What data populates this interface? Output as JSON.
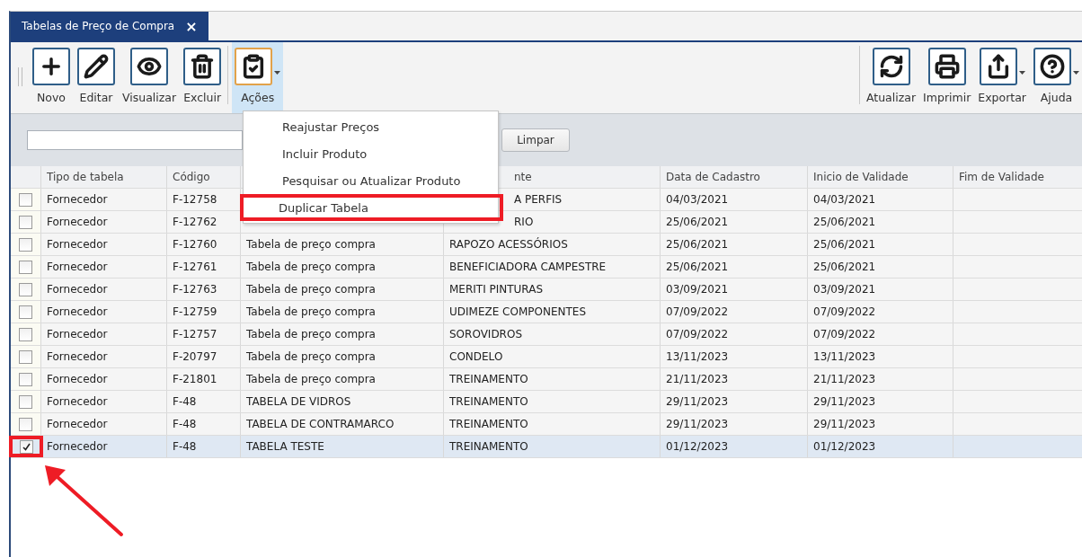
{
  "tab": {
    "title": "Tabelas de Preço de Compra",
    "close": "×",
    "selected": true
  },
  "toolbar_left": [
    {
      "label": "Novo",
      "selected": false,
      "dropdown": false
    },
    {
      "label": "Editar",
      "selected": false,
      "dropdown": false
    },
    {
      "label": "Visualizar",
      "selected": false,
      "dropdown": false
    },
    {
      "label": "Excluir",
      "selected": false,
      "dropdown": false
    },
    {
      "label": "Ações",
      "selected": true,
      "dropdown": true
    }
  ],
  "toolbar_right": [
    {
      "label": "Atualizar",
      "selected": false,
      "dropdown": false
    },
    {
      "label": "Imprimir",
      "selected": false,
      "dropdown": false
    },
    {
      "label": "Exportar",
      "selected": false,
      "dropdown": true
    },
    {
      "label": "Ajuda",
      "selected": false,
      "dropdown": true
    }
  ],
  "actions_menu": {
    "open": true,
    "items": [
      {
        "label": "Reajustar Preços",
        "annotated": false
      },
      {
        "label": "Incluir Produto",
        "annotated": false
      },
      {
        "label": "Pesquisar ou Atualizar Produto",
        "annotated": false
      },
      {
        "label": "Duplicar Tabela",
        "annotated": true
      }
    ]
  },
  "filter": {
    "clear_button": "Limpar"
  },
  "table": {
    "columns": [
      "Tipo de tabela",
      "Código",
      null,
      "nte",
      "Data de Cadastro",
      "Inicio de Validade",
      "Fim de Validade"
    ],
    "rows": [
      {
        "checked": false,
        "selected": false,
        "annotated": false,
        "cells": [
          "Fornecedor",
          "F-12758",
          null,
          "A PERFIS",
          "04/03/2021",
          "04/03/2021"
        ]
      },
      {
        "checked": false,
        "selected": false,
        "annotated": false,
        "cells": [
          "Fornecedor",
          "F-12762",
          null,
          "RIO",
          "25/06/2021",
          "25/06/2021"
        ]
      },
      {
        "checked": false,
        "selected": false,
        "annotated": false,
        "cells": [
          "Fornecedor",
          "F-12760",
          "Tabela de preço compra",
          "RAPOZO ACESSÓRIOS",
          "25/06/2021",
          "25/06/2021"
        ]
      },
      {
        "checked": false,
        "selected": false,
        "annotated": false,
        "cells": [
          "Fornecedor",
          "F-12761",
          "Tabela de preço compra",
          "BENEFICIADORA CAMPESTRE",
          "25/06/2021",
          "25/06/2021"
        ]
      },
      {
        "checked": false,
        "selected": false,
        "annotated": false,
        "cells": [
          "Fornecedor",
          "F-12763",
          "Tabela de preço compra",
          "MERITI PINTURAS",
          "03/09/2021",
          "03/09/2021"
        ]
      },
      {
        "checked": false,
        "selected": false,
        "annotated": false,
        "cells": [
          "Fornecedor",
          "F-12759",
          "Tabela de preço compra",
          "UDIMEZE COMPONENTES",
          "07/09/2022",
          "07/09/2022"
        ]
      },
      {
        "checked": false,
        "selected": false,
        "annotated": false,
        "cells": [
          "Fornecedor",
          "F-12757",
          "Tabela de preço compra",
          "SOROVIDROS",
          "07/09/2022",
          "07/09/2022"
        ]
      },
      {
        "checked": false,
        "selected": false,
        "annotated": false,
        "cells": [
          "Fornecedor",
          "F-20797",
          "Tabela de preço compra",
          "CONDELO",
          "13/11/2023",
          "13/11/2023"
        ]
      },
      {
        "checked": false,
        "selected": false,
        "annotated": false,
        "cells": [
          "Fornecedor",
          "F-21801",
          "Tabela de preço compra",
          "TREINAMENTO",
          "21/11/2023",
          "21/11/2023"
        ]
      },
      {
        "checked": false,
        "selected": false,
        "annotated": false,
        "cells": [
          "Fornecedor",
          "F-48",
          "TABELA DE VIDROS",
          "TREINAMENTO",
          "29/11/2023",
          "29/11/2023"
        ]
      },
      {
        "checked": false,
        "selected": false,
        "annotated": false,
        "cells": [
          "Fornecedor",
          "F-48",
          "TABELA DE CONTRAMARCO",
          "TREINAMENTO",
          "29/11/2023",
          "29/11/2023"
        ]
      },
      {
        "checked": true,
        "selected": true,
        "annotated": true,
        "cells": [
          "Fornecedor",
          "F-48",
          "TABELA TESTE",
          "TREINAMENTO",
          "01/12/2023",
          "01/12/2023"
        ]
      }
    ]
  }
}
